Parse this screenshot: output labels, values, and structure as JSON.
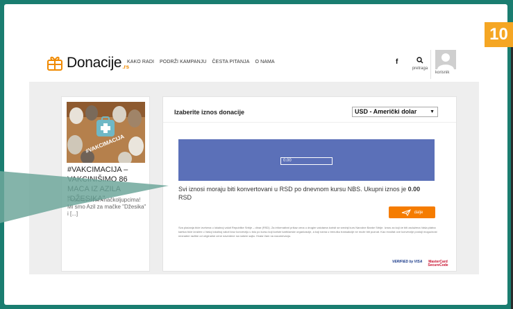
{
  "step_badge": "10",
  "logo": {
    "text": "Donacije",
    "tld": ".rs"
  },
  "nav": [
    {
      "label": "KAKO RADI"
    },
    {
      "label": "PODRŽI KAMPANJU"
    },
    {
      "label": "ČESTA PITANJA"
    },
    {
      "label": "O NAMA"
    }
  ],
  "header": {
    "facebook_label": "f",
    "search_label": "pretraga",
    "user_label": "korisnik"
  },
  "campaign": {
    "title": "#VAKCIMACIJA – VAKCINIŠIMO 86 MACA IZ AZILA “DŽESIKA”",
    "description": "Pozdrav svim mačkoljupcima! Mi smo Azil za mačke \"Džesika\" i [...]",
    "image_caption": "#VAKCIMACIJA"
  },
  "donation": {
    "title": "Izaberite iznos donacije",
    "currency": "USD - Američki dolar",
    "amount_value": "0.00",
    "note_prefix": "Svi iznosi moraju biti konvertovani u RSD po dnevnom kursu NBS. Ukupni iznos je ",
    "note_total": "0.00",
    "note_suffix": "RSD",
    "next_label": "dalje",
    "fine_print": "Sva plaćanja biće izvršena u lokalnoj valuti Republike Srbije – dinar (RSD). Za informativni prikaz cena u drugim valutama koristi se srednji kurs Narodne Banke Srbije. Iznos za koji će biti zadužena Vaša platna kartica biće izražen u Vašoj lokalnoj valuti kroz konverziju u istu po kursu koji koriste kartičarske organizacije, a koji nama u trenutku transakcije ne može biti poznat. Kao rezultat ove konverzije postoji mogućnost neznatne razlike od originalne cene navedene na našem sajtu. Hvala Vam na razumevanju.",
    "verified_visa": "VERIFIED by VISA",
    "mastercard": "MasterCard SecureCode"
  },
  "colors": {
    "background": "#1a7d70",
    "badge": "#f5a623",
    "amount_box": "#5b70b8",
    "button": "#f57c00"
  }
}
